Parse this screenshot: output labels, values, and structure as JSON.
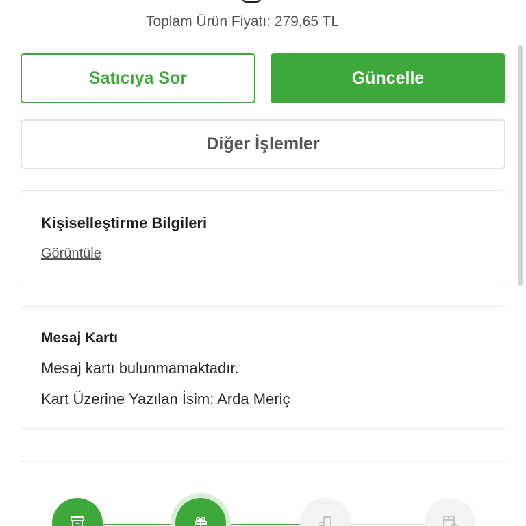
{
  "summary": {
    "total_price": "Toplam Ürün Fiyatı: 279,65 TL"
  },
  "actions": {
    "ask_seller": "Satıcıya Sor",
    "update": "Güncelle",
    "other_actions": "Diğer İşlemler"
  },
  "personalization": {
    "title": "Kişiselleştirme Bilgileri",
    "view_link": "Görüntüle"
  },
  "message_card": {
    "title": "Mesaj Kartı",
    "status": "Mesaj kartı bulunmamaktadır.",
    "name_on_card": "Kart Üzerine Yazılan İsim: Arda Meriç"
  },
  "progress": {
    "steps": [
      {
        "icon": "archive-box-icon",
        "state": "done"
      },
      {
        "icon": "gift-icon",
        "state": "active"
      },
      {
        "icon": "delivery-icon",
        "state": "pending"
      },
      {
        "icon": "package-check-icon",
        "state": "pending"
      }
    ]
  },
  "colors": {
    "accent": "#3fa83b",
    "accent_light": "#d7efd5",
    "pending": "#f3f3f3",
    "border": "#e3e3e3"
  }
}
